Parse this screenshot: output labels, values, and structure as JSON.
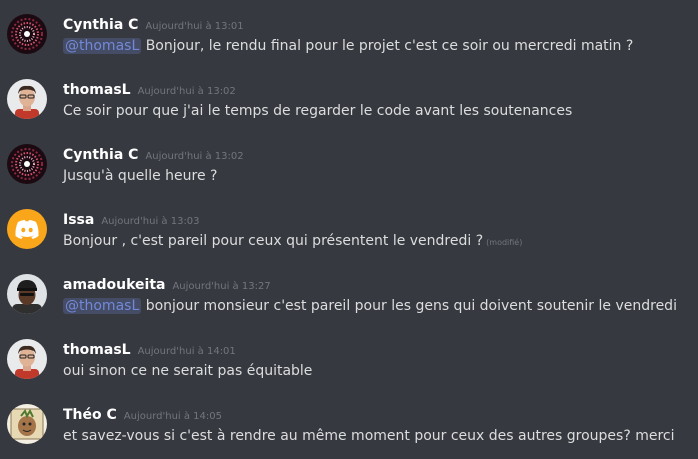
{
  "colors": {
    "background": "#36393f",
    "username": "#ffffff",
    "timestamp": "#72767d",
    "text": "#dcddde",
    "mention_text": "#7289da",
    "mention_bg": "#414675",
    "discord_orange": "#faa61a"
  },
  "messages": [
    {
      "author": "Cynthia C",
      "time": "Aujourd'hui à 13:01",
      "avatar_icon": "firework-avatar-icon",
      "mention": "@thomasL",
      "text": " Bonjour, le rendu final pour le projet c'est ce soir ou mercredi matin ?"
    },
    {
      "author": "thomasL",
      "time": "Aujourd'hui à 13:02",
      "avatar_icon": "man-photo-avatar-icon",
      "text": "Ce soir pour que j'ai le temps de regarder le code avant les soutenances"
    },
    {
      "author": "Cynthia C",
      "time": "Aujourd'hui à 13:02",
      "avatar_icon": "firework-avatar-icon",
      "text": "Jusqu'à quelle heure ?"
    },
    {
      "author": "Issa",
      "time": "Aujourd'hui à 13:03",
      "avatar_icon": "discord-logo-avatar-icon",
      "text": "Bonjour , c'est pareil pour ceux qui présentent le vendredi ?",
      "edited": "(modifié)"
    },
    {
      "author": "amadoukeita",
      "time": "Aujourd'hui à 13:27",
      "avatar_icon": "man-cap-photo-avatar-icon",
      "mention": "@thomasL",
      "text": "  bonjour monsieur  c'est pareil pour les gens qui doivent soutenir le vendredi"
    },
    {
      "author": "thomasL",
      "time": "Aujourd'hui à 14:01",
      "avatar_icon": "man-photo-avatar-icon",
      "text": "oui sinon ce ne serait pas équitable"
    },
    {
      "author": "Théo C",
      "time": "Aujourd'hui à 14:05",
      "avatar_icon": "cartoon-avatar-icon",
      "text": "et savez-vous si c'est à rendre au même moment pour ceux des autres groupes? merci"
    }
  ]
}
